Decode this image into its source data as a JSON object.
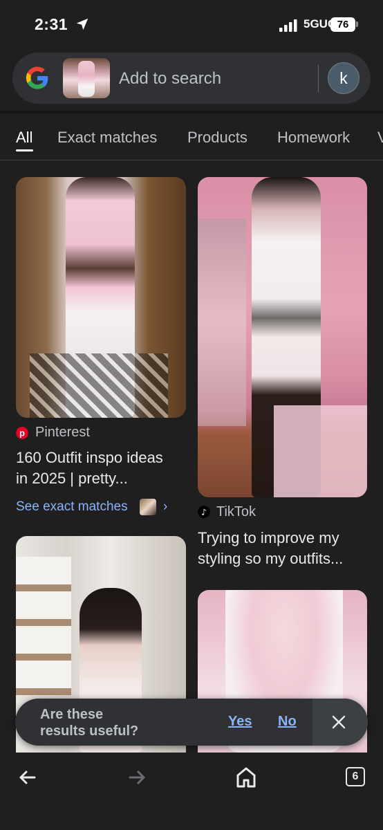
{
  "status_bar": {
    "time": "2:31",
    "network": "5GUC",
    "battery": "76"
  },
  "search": {
    "placeholder": "Add to search",
    "avatar_letter": "k"
  },
  "tabs": [
    {
      "label": "All",
      "active": true
    },
    {
      "label": "Exact matches"
    },
    {
      "label": "Products"
    },
    {
      "label": "Homework"
    },
    {
      "label": "V"
    }
  ],
  "results": [
    {
      "source": "Pinterest",
      "source_icon": "pinterest-icon",
      "title_line1": "160 Outfit inspo ideas",
      "title_line2": "in 2025 | pretty...",
      "exact_link": "See exact matches",
      "exact_chevron": "›"
    },
    {
      "source": "TikTok",
      "source_icon": "tiktok-icon",
      "title_line1": "Trying to improve my",
      "title_line2": "styling so my outfits..."
    }
  ],
  "feedback": {
    "question_line1": "Are these",
    "question_line2": "results useful?",
    "yes": "Yes",
    "no": "No"
  },
  "bottom_nav": {
    "tab_count": "6"
  },
  "colors": {
    "background": "#1f1f1f",
    "surface": "#303134",
    "link": "#8ab4f8",
    "text": "#e8eaed",
    "muted": "#bdc1c6"
  }
}
